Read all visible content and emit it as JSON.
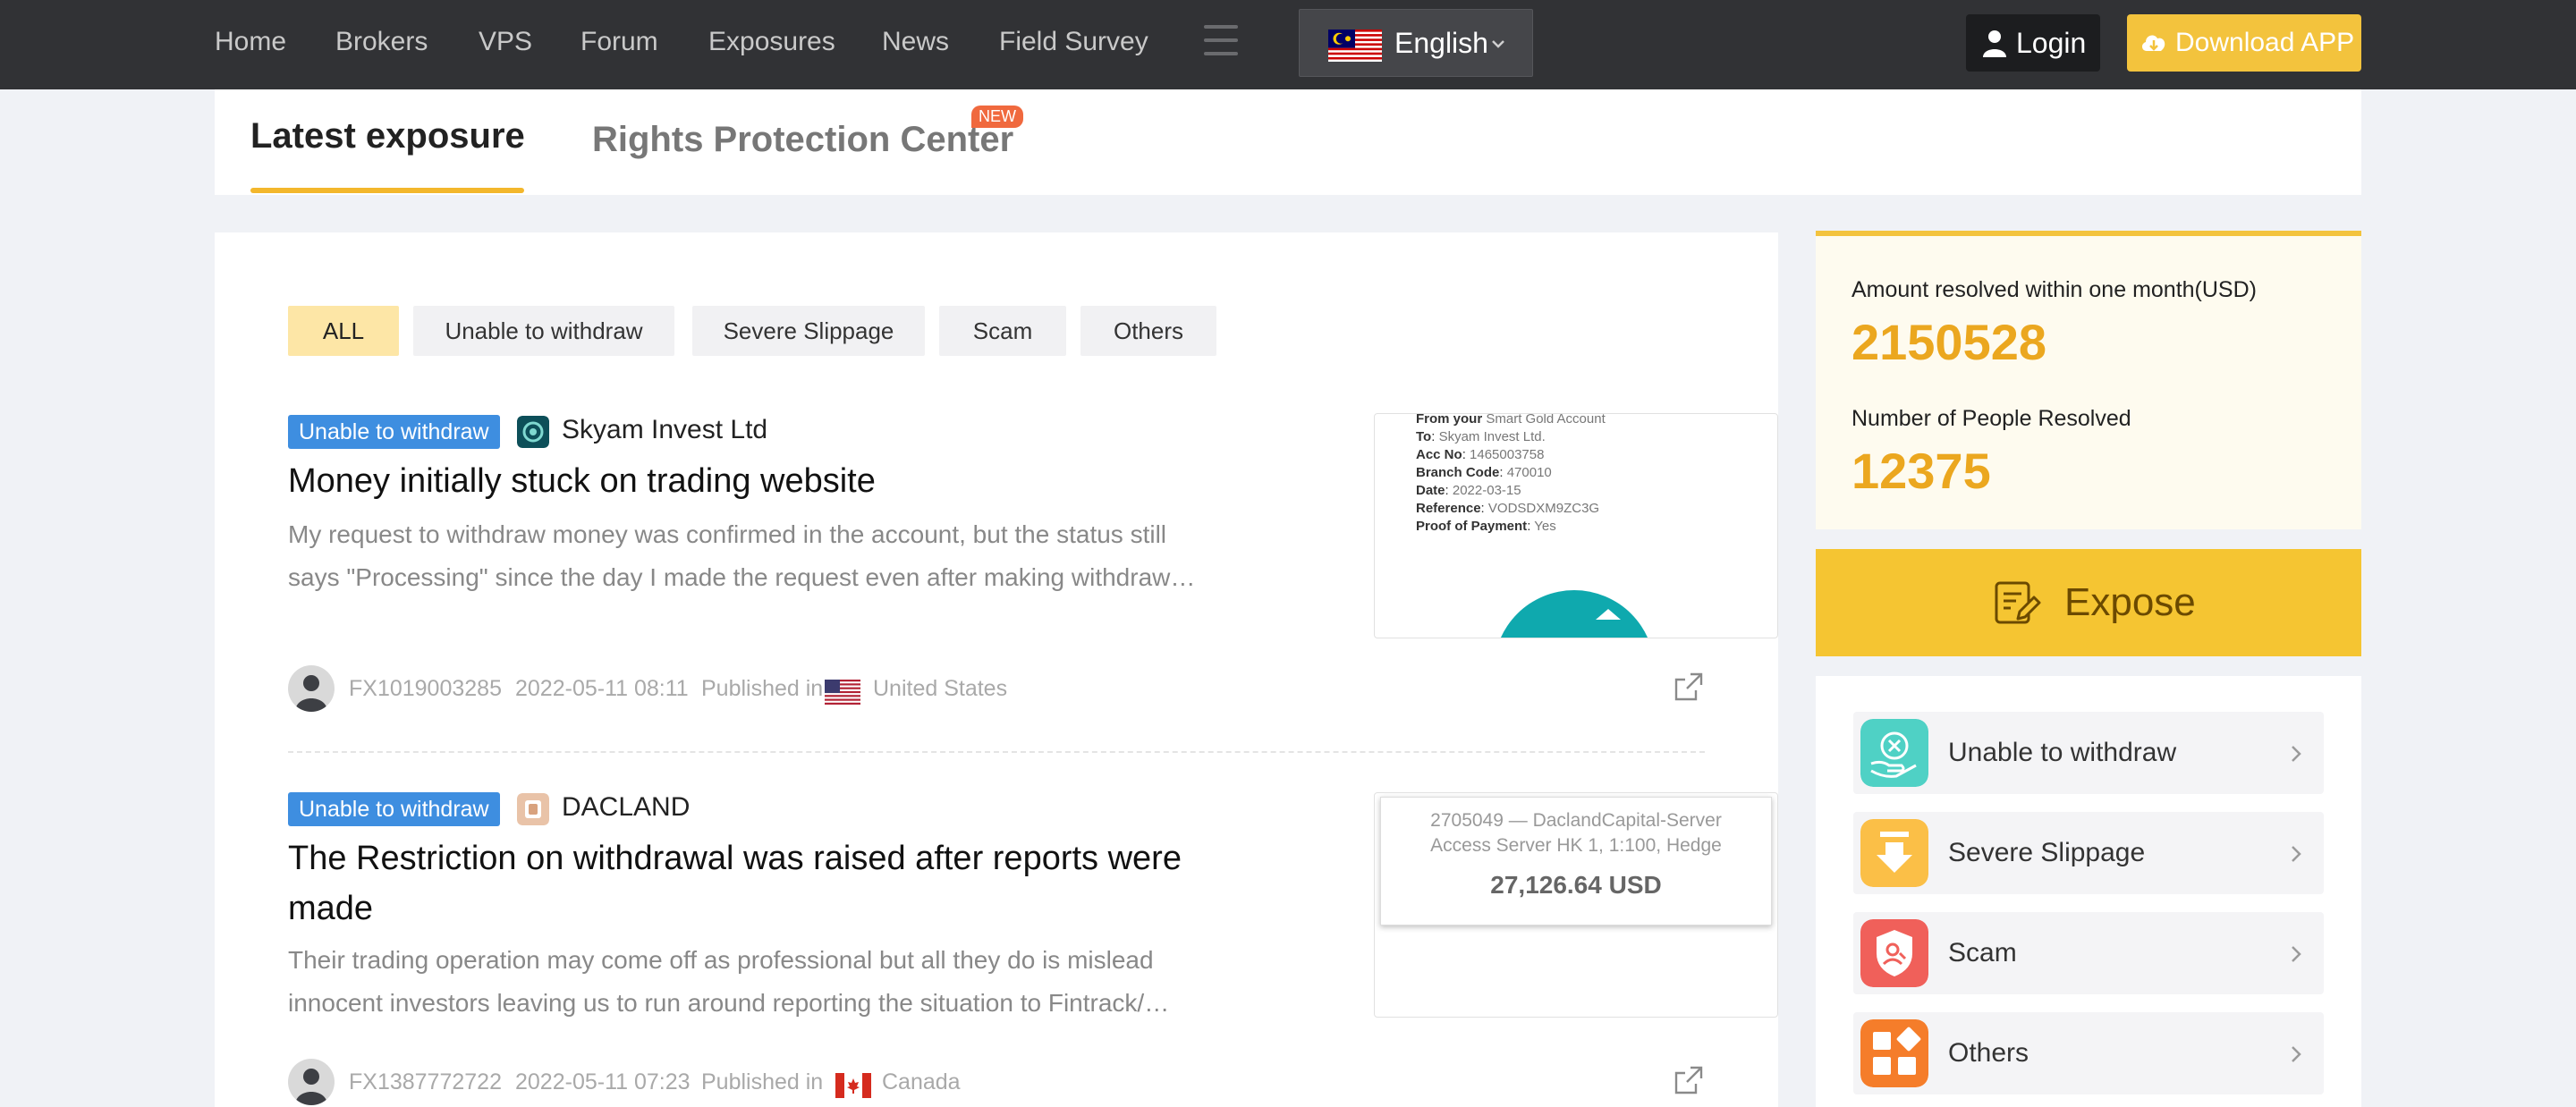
{
  "nav": {
    "items": [
      "Home",
      "Brokers",
      "VPS",
      "Forum",
      "Exposures",
      "News",
      "Field Survey"
    ],
    "language": "English",
    "login": "Login",
    "download": "Download APP"
  },
  "tabs": {
    "latest": "Latest exposure",
    "rights": "Rights Protection Center",
    "new_badge": "NEW"
  },
  "filters": [
    "ALL",
    "Unable to withdraw",
    "Severe Slippage",
    "Scam",
    "Others"
  ],
  "posts": [
    {
      "tag": "Unable to withdraw",
      "broker": "Skyam Invest Ltd",
      "title": "Money initially stuck on trading website",
      "body_line1": "My request to withdraw money was confirmed in the account, but the status still",
      "body_line2": "says \"Processing\" since the day I made the request even after making withdraw…",
      "user": "FX1019003285",
      "datetime": "2022-05-11 08:11",
      "published_in": "Published in",
      "country": "United States",
      "thumb": {
        "line1_label": "From your",
        "line1_value": "Smart Gold Account",
        "to_label": "To",
        "to_value": "Skyam Invest Ltd.",
        "acc_label": "Acc No",
        "acc_value": "1465003758",
        "branch_label": "Branch Code",
        "branch_value": "470010",
        "date_label": "Date",
        "date_value": "2022-03-15",
        "ref_label": "Reference",
        "ref_value": "VODSDXM9ZC3G",
        "proof_label": "Proof of Payment",
        "proof_value": "Yes"
      }
    },
    {
      "tag": "Unable to withdraw",
      "broker": "DACLAND",
      "title_line1": "The Restriction on withdrawal was raised after reports were",
      "title_line2": "made",
      "body_line1": "Their trading operation may come off as professional but all they do is mislead",
      "body_line2": "innocent investors leaving us to run around reporting the situation to Fintrack/…",
      "user": "FX1387772722",
      "datetime": "2022-05-11 07:23",
      "published_in": "Published in",
      "country": "Canada",
      "thumb": {
        "line1": "2705049 — DaclandCapital-Server",
        "line2": "Access Server HK 1, 1:100, Hedge",
        "amount": "27,126.64 USD"
      }
    }
  ],
  "stats": {
    "amount_label": "Amount resolved within one month(USD)",
    "amount_value": "2150528",
    "people_label": "Number of People Resolved",
    "people_value": "12375"
  },
  "expose_label": "Expose",
  "categories": [
    {
      "label": "Unable to withdraw",
      "color": "#4fd1c5"
    },
    {
      "label": "Severe Slippage",
      "color": "#fbbf47"
    },
    {
      "label": "Scam",
      "color": "#f0605a"
    },
    {
      "label": "Others",
      "color": "#f57d2a"
    }
  ]
}
